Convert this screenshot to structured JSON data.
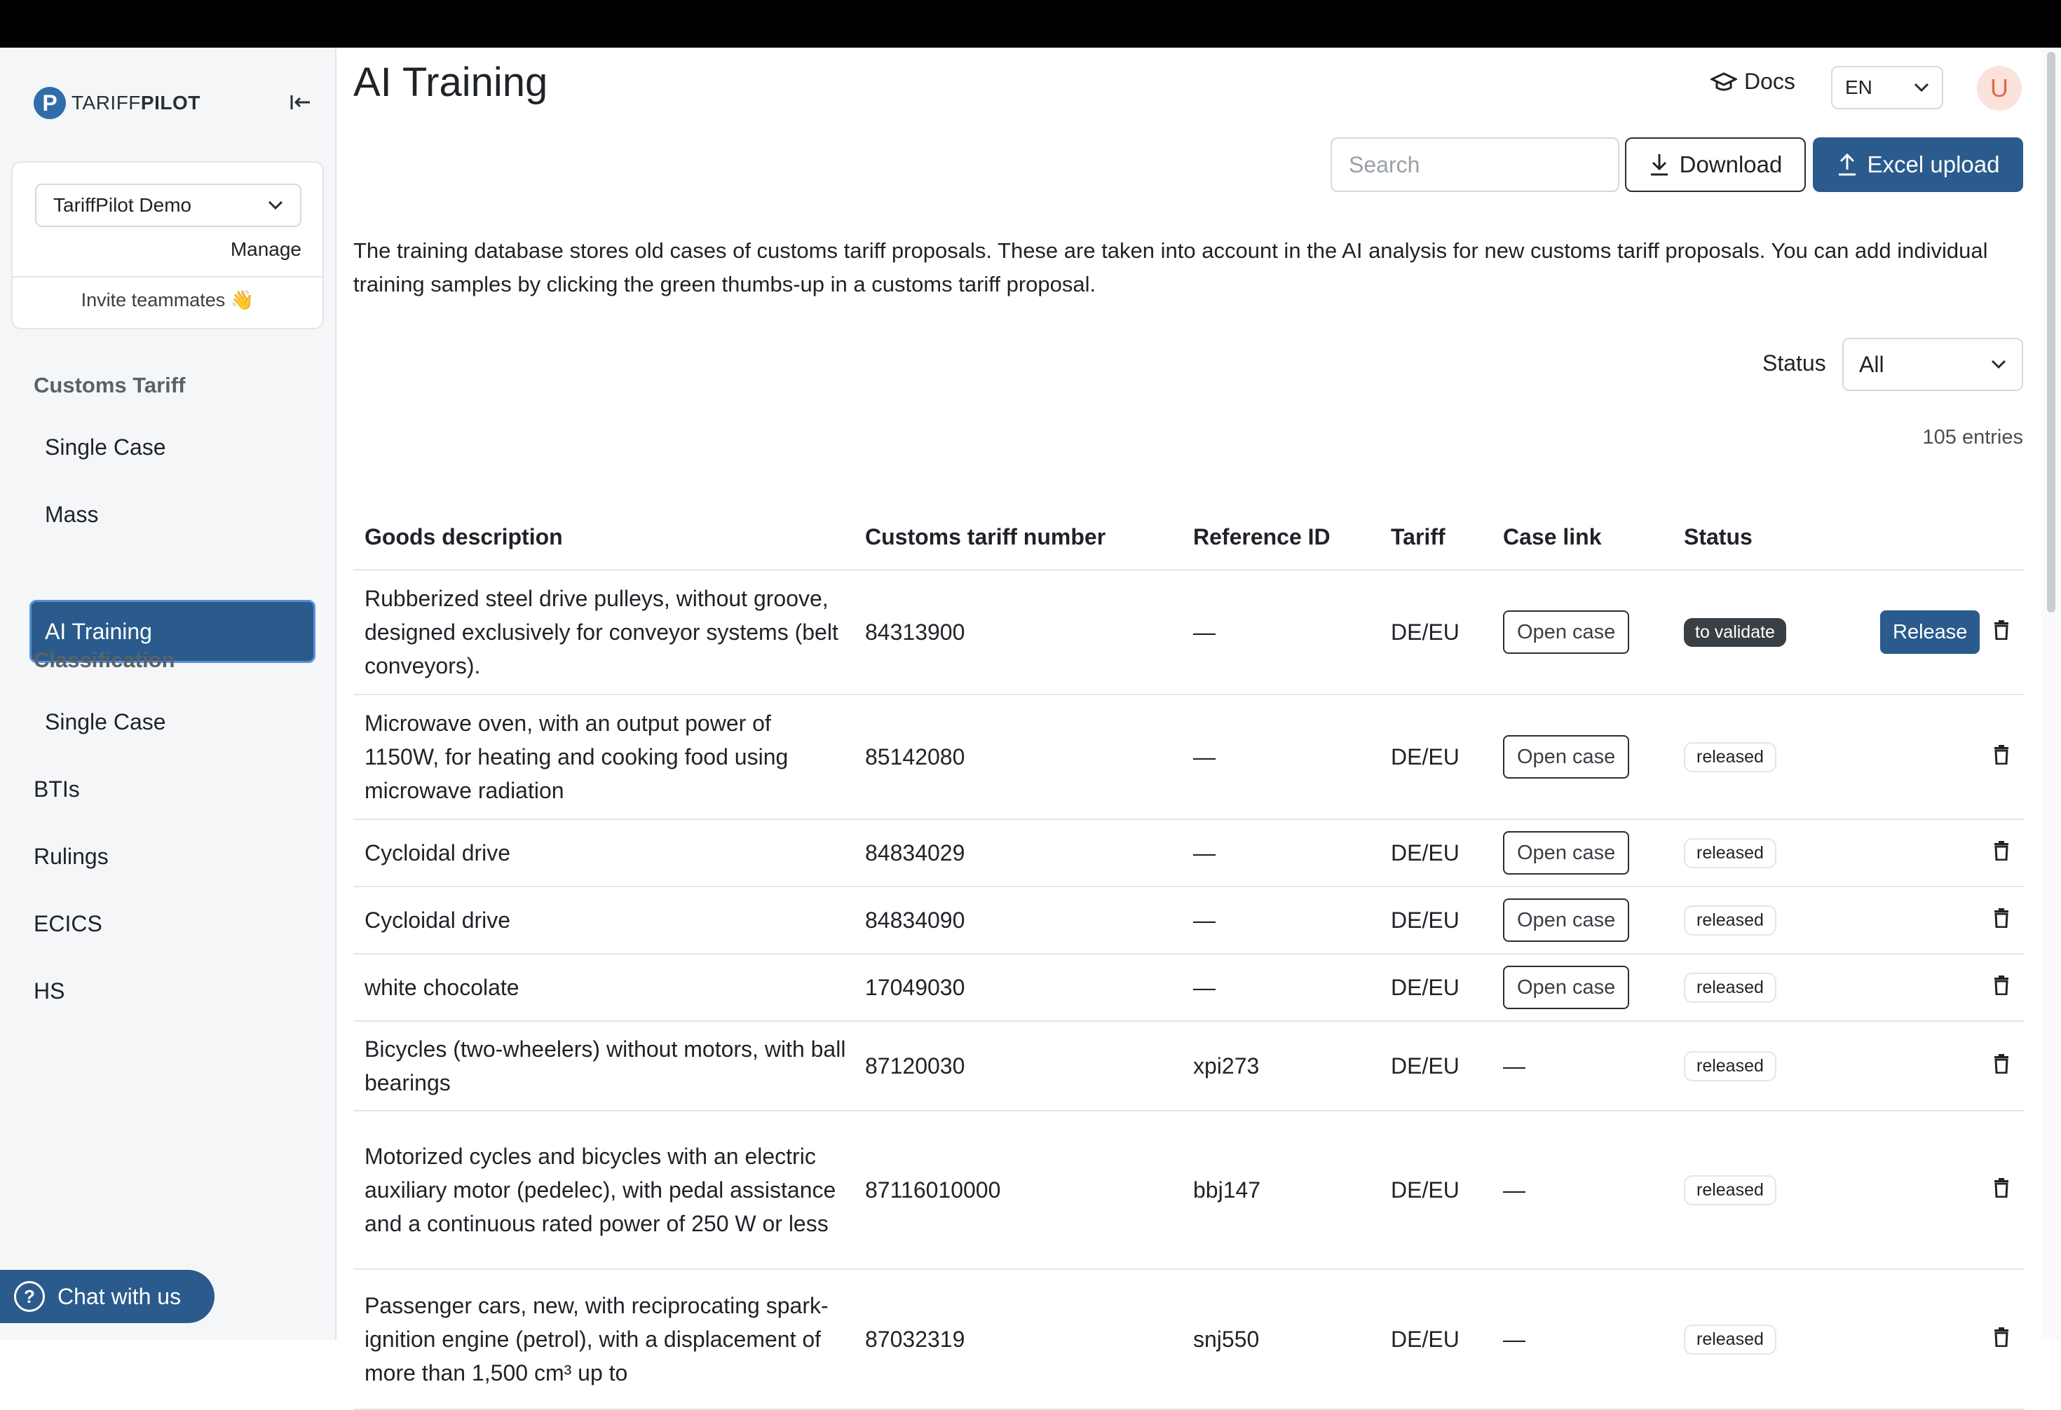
{
  "app": {
    "brand_light": "TARIFF",
    "brand_bold": "PILOT",
    "brand_color": "#2a5b8c"
  },
  "sidebar": {
    "workspace": "TariffPilot Demo",
    "manage_label": "Manage",
    "invite_label": "Invite teammates 👋",
    "section_customs": "Customs Tariff",
    "customs_items": [
      "Single Case",
      "Mass",
      "AI Training"
    ],
    "active_item": "AI Training",
    "section_classification": "Classification",
    "classification_items": [
      "Single Case"
    ],
    "top_items": [
      "BTIs",
      "Rulings",
      "ECICS",
      "HS"
    ],
    "chat_label": "Chat with us"
  },
  "header": {
    "title": "AI Training",
    "docs_label": "Docs",
    "language": "EN",
    "avatar_initial": "U"
  },
  "toolbar": {
    "search_placeholder": "Search",
    "download_label": "Download",
    "upload_label": "Excel upload"
  },
  "description": "The training database stores old cases of customs tariff proposals. These are taken into account in the AI analysis for new customs tariff proposals. You can add individual training samples by clicking the green thumbs-up in a customs tariff proposal.",
  "filter": {
    "label": "Status",
    "value": "All"
  },
  "entries_label": "105 entries",
  "table": {
    "columns": [
      "Goods description",
      "Customs tariff number",
      "Reference ID",
      "Tariff",
      "Case link",
      "Status"
    ],
    "rows": [
      {
        "goods": "Rubberized steel drive pulleys, without groove, designed exclusively for conveyor systems (belt conveyors).",
        "number": "84313900",
        "ref": "—",
        "tariff": "DE/EU",
        "link": "Open case",
        "status": "to validate",
        "release": "Release"
      },
      {
        "goods": "Microwave oven, with an output power of 1150W, for heating and cooking food using microwave radiation",
        "number": "85142080",
        "ref": "—",
        "tariff": "DE/EU",
        "link": "Open case",
        "status": "released"
      },
      {
        "goods": "Cycloidal drive",
        "number": "84834029",
        "ref": "—",
        "tariff": "DE/EU",
        "link": "Open case",
        "status": "released"
      },
      {
        "goods": "Cycloidal drive",
        "number": "84834090",
        "ref": "—",
        "tariff": "DE/EU",
        "link": "Open case",
        "status": "released"
      },
      {
        "goods": "white chocolate",
        "number": "17049030",
        "ref": "—",
        "tariff": "DE/EU",
        "link": "Open case",
        "status": "released"
      },
      {
        "goods": "Bicycles (two-wheelers) without motors, with ball bearings",
        "number": "87120030",
        "ref": "xpi273",
        "tariff": "DE/EU",
        "link": "—",
        "status": "released"
      },
      {
        "goods": "Motorized cycles and bicycles with an electric auxiliary motor (pedelec), with pedal assistance and a continuous rated power of 250 W or less",
        "number": "87116010000",
        "ref": "bbj147",
        "tariff": "DE/EU",
        "link": "—",
        "status": "released"
      },
      {
        "goods": "Passenger cars, new, with reciprocating spark-ignition engine (petrol), with a displacement of more than 1,500 cm³ up to",
        "number": "87032319",
        "ref": "snj550",
        "tariff": "DE/EU",
        "link": "—",
        "status": "released"
      }
    ]
  }
}
